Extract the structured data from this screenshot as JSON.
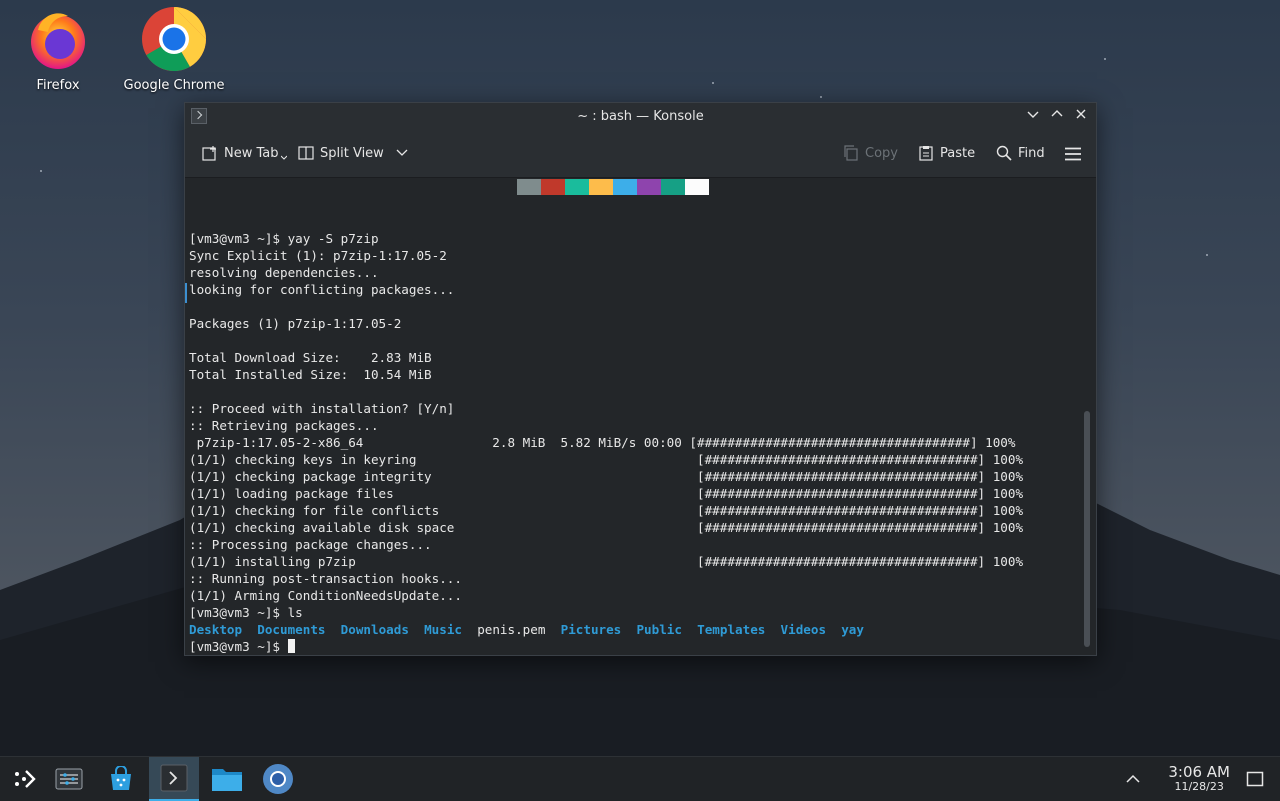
{
  "desktop": {
    "icons": [
      {
        "label": "Firefox",
        "icon": "firefox-icon"
      },
      {
        "label": "Google Chrome",
        "icon": "chrome-icon"
      }
    ]
  },
  "window": {
    "title": "~ : bash — Konsole",
    "toolbar": {
      "new_tab": "New Tab",
      "split_view": "Split View",
      "copy": "Copy",
      "paste": "Paste",
      "find": "Find"
    },
    "palette": [
      "#7f8c8d",
      "#c0392b",
      "#1abc9c",
      "#fdbc4b",
      "#3daee9",
      "#8e44ad",
      "#16a085",
      "#fcfcfc"
    ]
  },
  "terminal": {
    "lines": [
      "[vm3@vm3 ~]$ yay -S p7zip",
      "Sync Explicit (1): p7zip-1:17.05-2",
      "resolving dependencies...",
      "looking for conflicting packages...",
      "",
      "Packages (1) p7zip-1:17.05-2",
      "",
      "Total Download Size:    2.83 MiB",
      "Total Installed Size:  10.54 MiB",
      "",
      ":: Proceed with installation? [Y/n]",
      ":: Retrieving packages...",
      " p7zip-1:17.05-2-x86_64                 2.8 MiB  5.82 MiB/s 00:00 [####################################] 100%",
      "(1/1) checking keys in keyring                                     [####################################] 100%",
      "(1/1) checking package integrity                                   [####################################] 100%",
      "(1/1) loading package files                                        [####################################] 100%",
      "(1/1) checking for file conflicts                                  [####################################] 100%",
      "(1/1) checking available disk space                                [####################################] 100%",
      ":: Processing package changes...",
      "(1/1) installing p7zip                                             [####################################] 100%",
      ":: Running post-transaction hooks...",
      "(1/1) Arming ConditionNeedsUpdate...",
      "[vm3@vm3 ~]$ ls"
    ],
    "ls_output": [
      {
        "name": "Desktop",
        "dir": true
      },
      {
        "name": "Documents",
        "dir": true
      },
      {
        "name": "Downloads",
        "dir": true
      },
      {
        "name": "Music",
        "dir": true
      },
      {
        "name": "penis.pem",
        "dir": false
      },
      {
        "name": "Pictures",
        "dir": true
      },
      {
        "name": "Public",
        "dir": true
      },
      {
        "name": "Templates",
        "dir": true
      },
      {
        "name": "Videos",
        "dir": true
      },
      {
        "name": "yay",
        "dir": true
      }
    ],
    "prompt": "[vm3@vm3 ~]$ "
  },
  "taskbar": {
    "time": "3:06 AM",
    "date": "11/28/23",
    "items": [
      "app-launcher-icon",
      "system-settings-icon",
      "discover-icon",
      "konsole-icon",
      "dolphin-icon",
      "chromium-icon"
    ]
  },
  "colors": {
    "accent": "#3daee9",
    "dir": "#2f9bd6",
    "terminal_bg": "#232629"
  }
}
